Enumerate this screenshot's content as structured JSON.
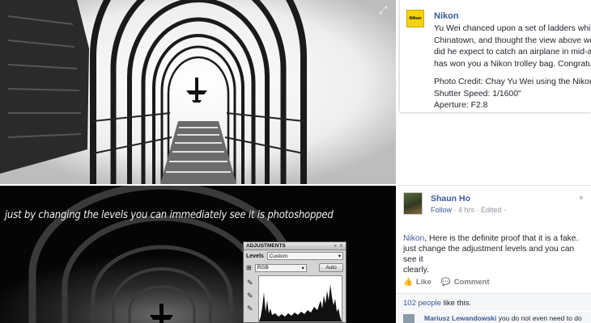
{
  "photo_top": {
    "expand_icon": "expand-icon"
  },
  "photo_bottom": {
    "caption": "just by changing the levels you can immediately see it is photoshopped"
  },
  "ps_panel": {
    "title": "ADJUSTMENTS",
    "title_icons": "» ≡",
    "levels_label": "Levels",
    "preset_value": "Custom",
    "channel_value": "RGB",
    "auto_label": "Auto"
  },
  "nikon_post": {
    "logo_text": "Nikon",
    "page_name": "Nikon",
    "lines": [
      "Yu Wei chanced upon a set of ladders whil",
      "Chinatown, and thought the view above wc",
      "did he expect to catch an airplane in mid-a",
      "has won you a Nikon trolley bag. Congratu"
    ],
    "credit_lines": [
      "Photo Credit: Chay Yu Wei using the Nikor",
      "Shutter Speed: 1/1600\"",
      "Aperture: F2.8"
    ]
  },
  "comment": {
    "author": "Shaun Ho",
    "follow": "Follow",
    "meta": " · 4 hrs · Edited ·",
    "mention": "Nikon",
    "text_line1_rest": ", Here is the definite proof that it is a fake.",
    "text_line2": "just change the adjustment levels and you can see it",
    "text_line3": "clearly.",
    "like_label": "Like",
    "comment_label": "Comment",
    "likes_count": "102 people",
    "likes_suffix": " like this.",
    "reply_author": "Mariusz Lewandowski",
    "reply_text": " you do not even need to do"
  }
}
